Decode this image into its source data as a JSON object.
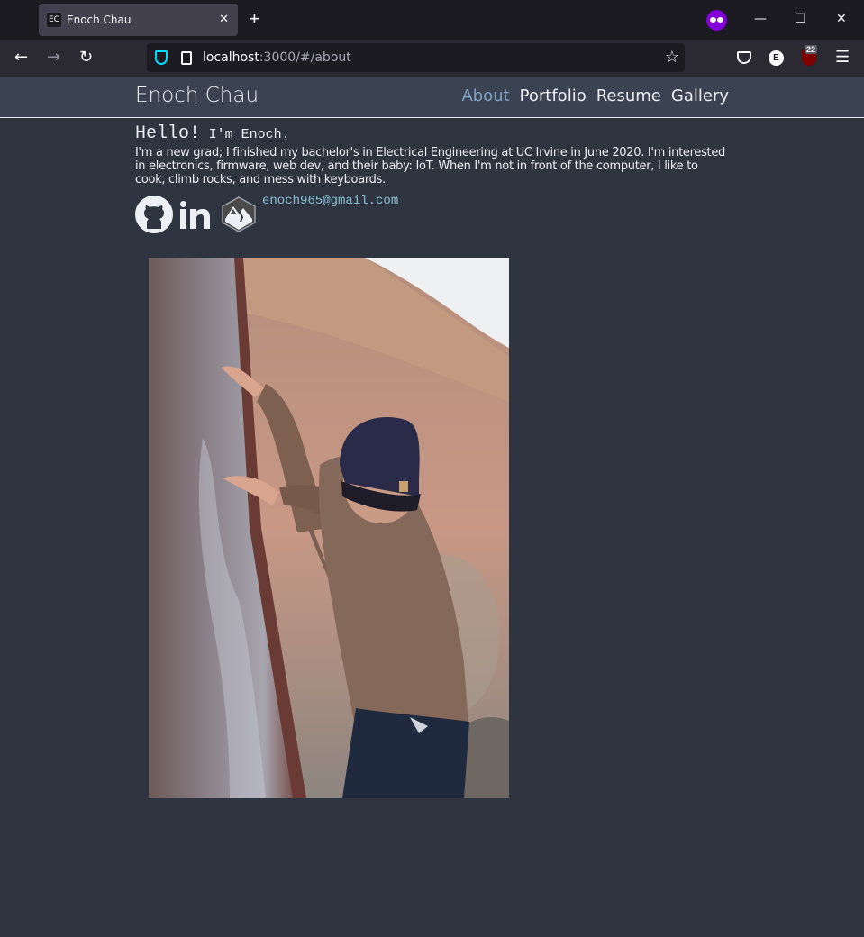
{
  "browser": {
    "tab_favicon": "EC",
    "tab_title": "Enoch Chau",
    "url_host": "localhost",
    "url_rest": ":3000/#/about",
    "ublock_count": "22",
    "ext_e_label": "E"
  },
  "site": {
    "brand": "Enoch Chau",
    "nav": [
      {
        "label": "About",
        "active": true
      },
      {
        "label": "Portfolio",
        "active": false
      },
      {
        "label": "Resume",
        "active": false
      },
      {
        "label": "Gallery",
        "active": false
      }
    ]
  },
  "about": {
    "greeting_big": "Hello!",
    "greeting_small": "I'm Enoch.",
    "bio": "I'm a new grad; I finished my bachelor's in Electrical Engineering at UC Irvine in June 2020. I'm interested in electronics, firmware, web dev, and their baby: IoT. When I'm not in front of the computer, I like to cook, climb rocks, and mess with keyboards.",
    "email": "enoch965@gmail.com",
    "socials": [
      {
        "icon": "github-icon"
      },
      {
        "icon": "linkedin-icon"
      },
      {
        "icon": "mountain-project-icon"
      }
    ]
  },
  "colors": {
    "page_bg": "#2e3440",
    "header_bg": "#3b4252",
    "text": "#eceff4",
    "accent": "#81a1c1",
    "link": "#88c0d0"
  }
}
